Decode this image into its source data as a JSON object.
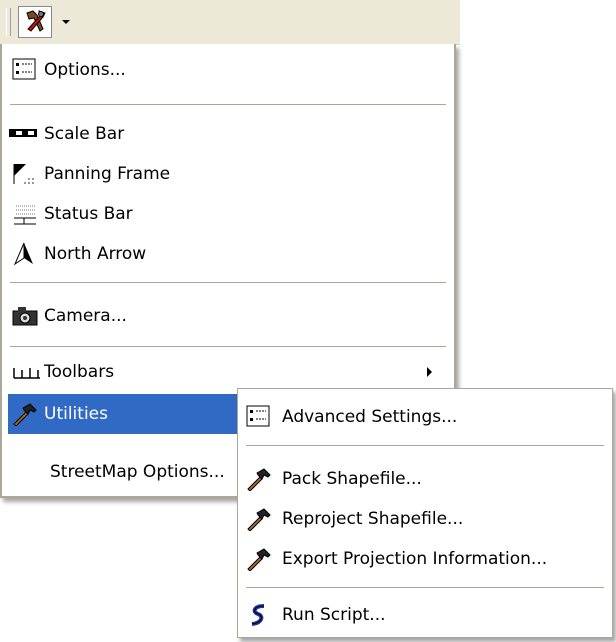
{
  "toolbar": {
    "tool_icon": "tools-hammer-wrench-icon",
    "dropdown_icon": "chevron-down-icon"
  },
  "main_menu": {
    "items": [
      {
        "label": "Options...",
        "icon": "options-icon"
      },
      {
        "label": "Scale Bar",
        "icon": "scale-bar-icon"
      },
      {
        "label": "Panning Frame",
        "icon": "panning-frame-icon"
      },
      {
        "label": "Status Bar",
        "icon": "status-bar-icon"
      },
      {
        "label": "North Arrow",
        "icon": "north-arrow-icon"
      },
      {
        "label": "Camera...",
        "icon": "camera-icon"
      },
      {
        "label": "Toolbars",
        "icon": "toolbars-icon"
      },
      {
        "label": "Utilities",
        "icon": "hammer-icon"
      },
      {
        "label": "StreetMap Options...",
        "icon": ""
      }
    ]
  },
  "sub_menu": {
    "items": [
      {
        "label": "Advanced Settings...",
        "icon": "options-icon"
      },
      {
        "label": "Pack Shapefile...",
        "icon": "hammer-icon"
      },
      {
        "label": "Reproject Shapefile...",
        "icon": "hammer-icon"
      },
      {
        "label": "Export Projection Information...",
        "icon": "hammer-icon"
      },
      {
        "label": "Run Script...",
        "icon": "script-icon"
      }
    ]
  },
  "colors": {
    "highlight": "#316ac5",
    "toolbar_bg": "#ece9d8",
    "border": "#aca899"
  }
}
